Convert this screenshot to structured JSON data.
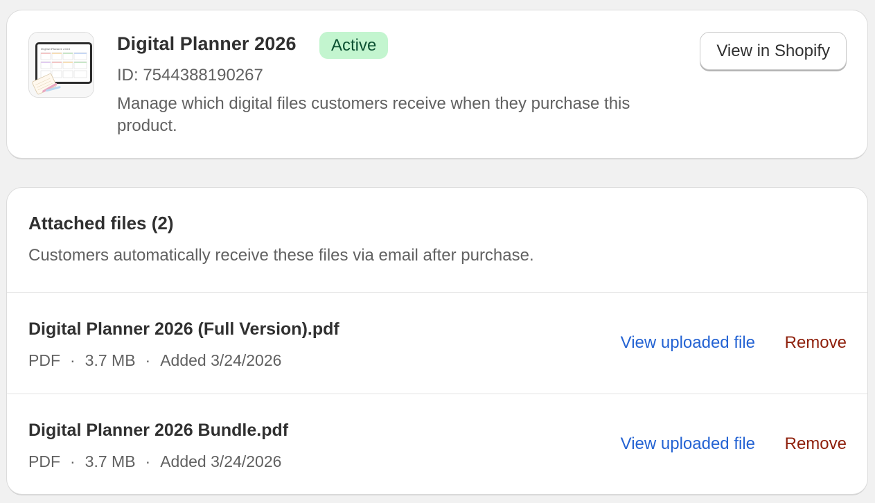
{
  "product": {
    "title": "Digital Planner 2026",
    "status": "Active",
    "id_text": "ID: 7544388190267",
    "description": "Manage which digital files customers receive when they purchase this product.",
    "view_button": "View in Shopify",
    "thumbnail_text": "Digital Planner 2026"
  },
  "files": {
    "title": "Attached files (2)",
    "subtitle": "Customers automatically receive these files via email after purchase.",
    "items": [
      {
        "name": "Digital Planner 2026 (Full Version).pdf",
        "type": "PDF",
        "size": "3.7 MB",
        "added": "Added 3/24/2026",
        "view_label": "View uploaded file",
        "remove_label": "Remove"
      },
      {
        "name": "Digital Planner 2026 Bundle.pdf",
        "type": "PDF",
        "size": "3.7 MB",
        "added": "Added 3/24/2026",
        "view_label": "View uploaded file",
        "remove_label": "Remove"
      }
    ],
    "separator": "·"
  },
  "colors": {
    "badge_bg": "#c3f5cf",
    "badge_text": "#0c5132",
    "link_blue": "#2463d3",
    "remove_red": "#8e1f0b"
  }
}
